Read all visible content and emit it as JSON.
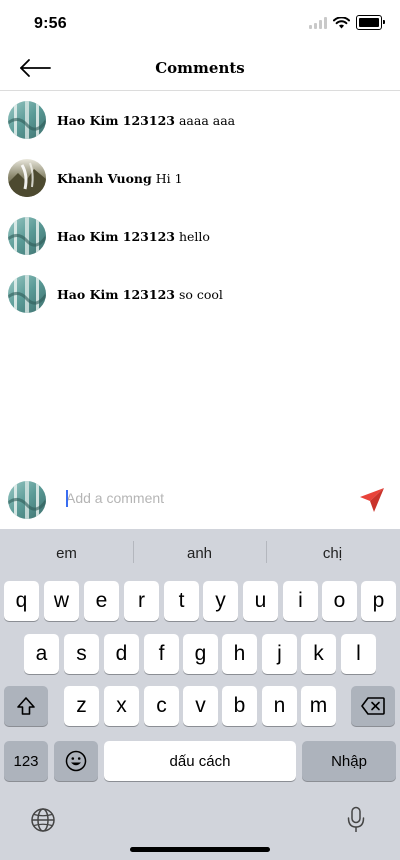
{
  "status_bar": {
    "time": "9:56"
  },
  "header": {
    "title": "Comments"
  },
  "comments": [
    {
      "user": "Hao Kim 123123",
      "text": "aaaa aaa",
      "avatar": "teal-avatar"
    },
    {
      "user": "Khanh Vuong",
      "text": "Hi 1",
      "avatar": "landscape-avatar"
    },
    {
      "user": "Hao Kim 123123",
      "text": "hello",
      "avatar": "teal-avatar"
    },
    {
      "user": "Hao Kim 123123",
      "text": "so cool",
      "avatar": "teal-avatar"
    }
  ],
  "input": {
    "placeholder": "Add a comment",
    "value": ""
  },
  "keyboard": {
    "suggestions": [
      "em",
      "anh",
      "chị"
    ],
    "row1": [
      "q",
      "w",
      "e",
      "r",
      "t",
      "y",
      "u",
      "i",
      "o",
      "p"
    ],
    "row2": [
      "a",
      "s",
      "d",
      "f",
      "g",
      "h",
      "j",
      "k",
      "l"
    ],
    "row3": [
      "z",
      "x",
      "c",
      "v",
      "b",
      "n",
      "m"
    ],
    "numbers_key": "123",
    "space_key": "dấu cách",
    "return_key": "Nhập"
  },
  "colors": {
    "accent_send": "#e8433a",
    "keyboard_bg": "#d1d4db",
    "caret": "#3a6df0"
  }
}
